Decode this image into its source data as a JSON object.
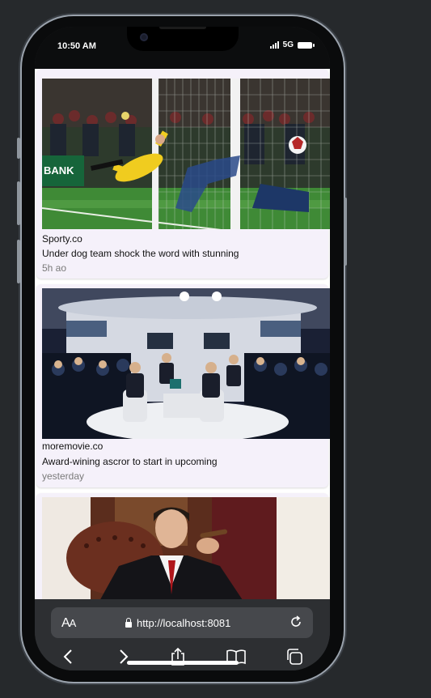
{
  "status_bar": {
    "time": "10:50 AM",
    "network": "5G"
  },
  "feed": [
    {
      "source": "Sporty.co",
      "headline": "Under dog team shock the word with stunning",
      "time_ago": "5h ao",
      "image": "football-goalkeeper-photo"
    },
    {
      "source": "moremovie.co",
      "headline": "Award-wining ascror to start in upcoming",
      "time_ago": "yesterday",
      "image": "panel-discussion-photo"
    },
    {
      "source": "",
      "headline": "",
      "time_ago": "",
      "image": "man-with-cigar-photo"
    }
  ],
  "browser": {
    "text_size_label_big": "A",
    "text_size_label_small": "A",
    "url": "http://localhost:8081"
  },
  "icons": {
    "back": "chevron-left-icon",
    "forward": "chevron-right-icon",
    "share": "share-icon",
    "bookmarks": "book-icon",
    "tabs": "tabs-icon",
    "reload": "reload-icon",
    "lock": "lock-icon"
  },
  "colors": {
    "card_bg": "#f5f1fa",
    "browser_bg": "#2d2f32",
    "urlbar_bg": "#46484c"
  }
}
